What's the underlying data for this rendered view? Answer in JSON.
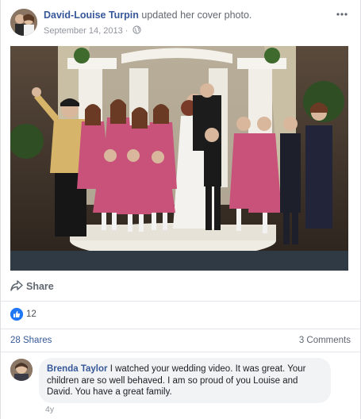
{
  "post": {
    "author": "David-Louise Turpin",
    "action": "updated her cover photo.",
    "date": "September 14, 2013",
    "date_separator": "·",
    "more_icon": "more-horizontal-icon",
    "privacy_icon": "globe-icon"
  },
  "actions": {
    "share_label": "Share",
    "share_icon": "share-arrow-icon"
  },
  "reactions": {
    "icon": "thumbs-up-icon",
    "count": "12",
    "color": "#2078f4"
  },
  "stats": {
    "shares": "28 Shares",
    "comments": "3 Comments"
  },
  "comment": {
    "author": "Brenda Taylor",
    "text": "I watched your wedding video. It was great. Your children are so well behaved. I am so proud of you Louise and David. You have a great family.",
    "age": "4y"
  },
  "colors": {
    "link": "#365899",
    "muted": "#90949c",
    "bubble": "#f2f3f5"
  }
}
